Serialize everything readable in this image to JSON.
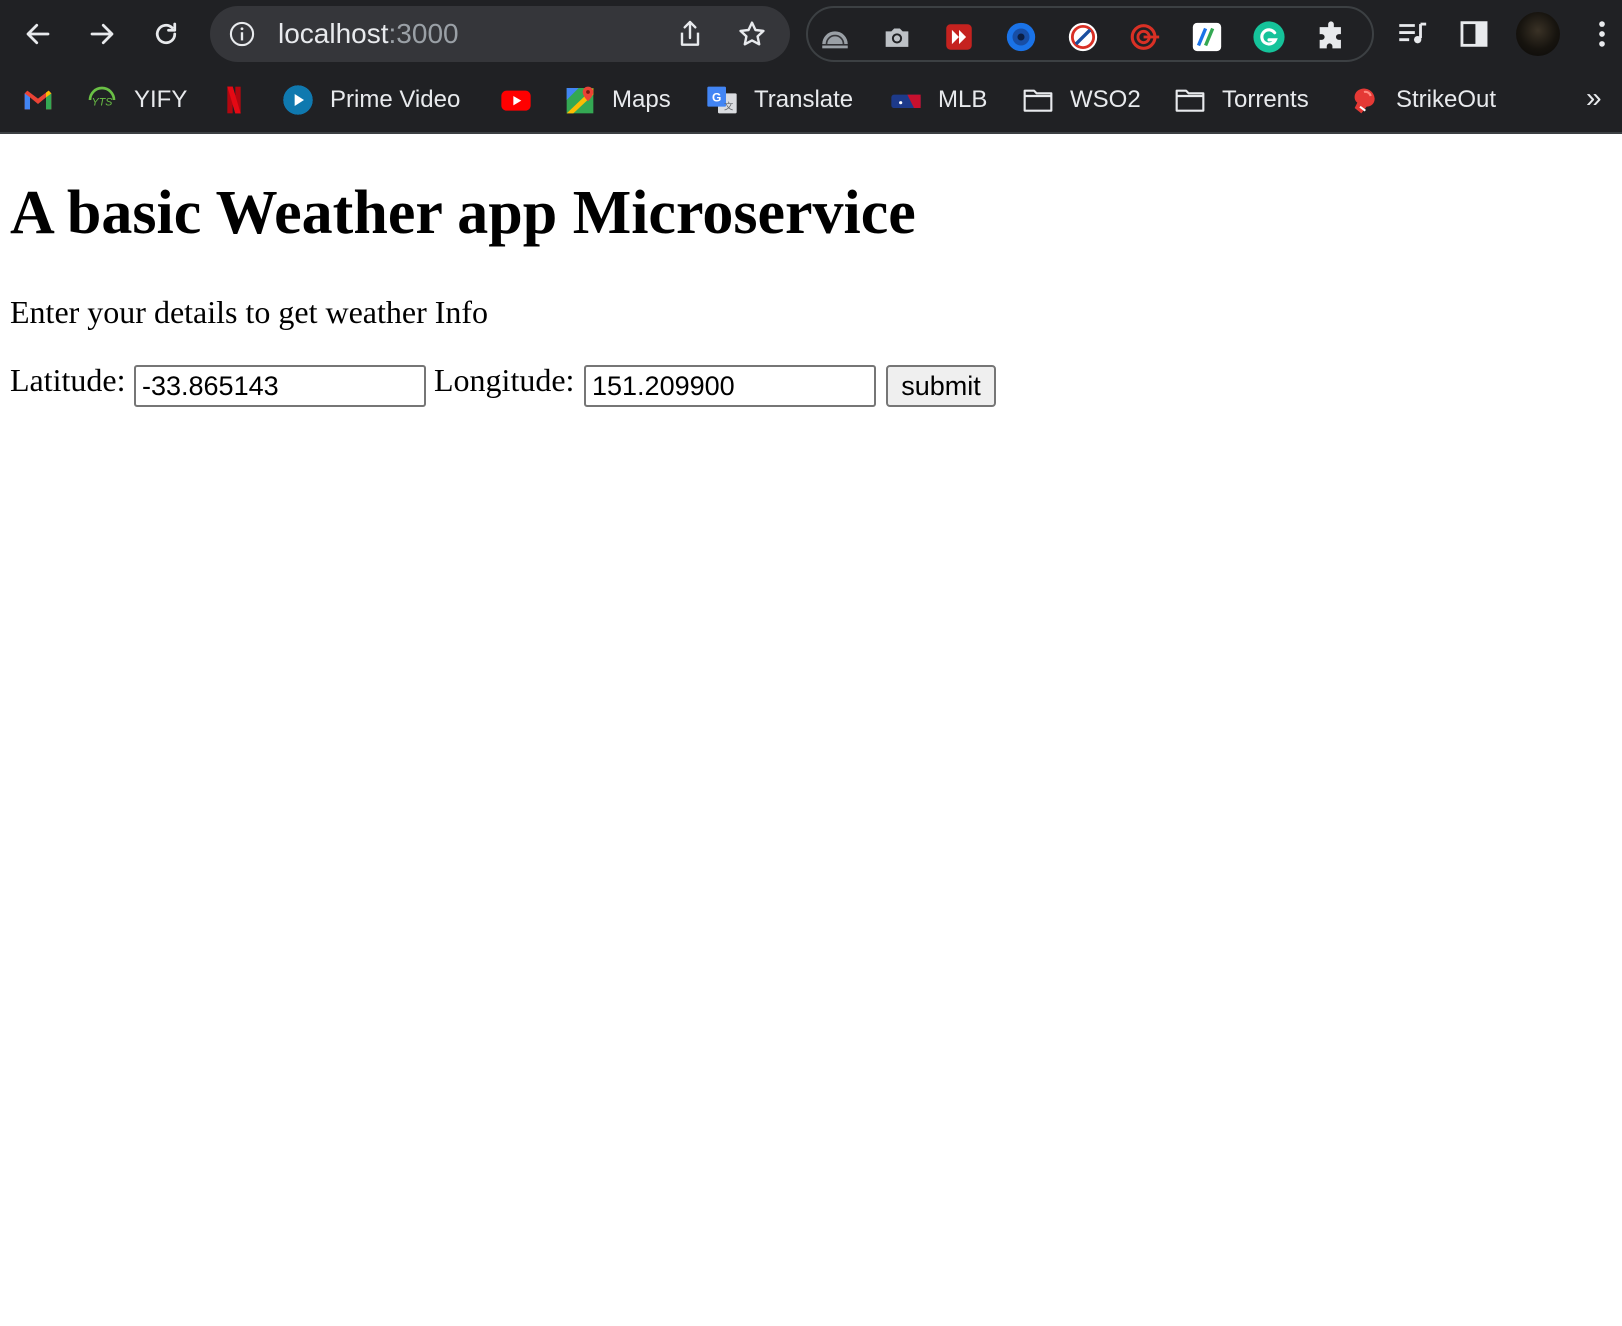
{
  "browser": {
    "address": {
      "host": "localhost",
      "port": ":3000"
    },
    "bookmarks": [
      {
        "label": "",
        "icon": "gmail-icon"
      },
      {
        "label": "YIFY",
        "icon": "yts-icon"
      },
      {
        "label": "",
        "icon": "netflix-icon"
      },
      {
        "label": "Prime Video",
        "icon": "prime-video-icon"
      },
      {
        "label": "",
        "icon": "youtube-icon"
      },
      {
        "label": "Maps",
        "icon": "maps-icon"
      },
      {
        "label": "Translate",
        "icon": "translate-icon"
      },
      {
        "label": "MLB",
        "icon": "mlb-icon"
      },
      {
        "label": "WSO2",
        "icon": "folder-icon"
      },
      {
        "label": "Torrents",
        "icon": "folder-icon"
      },
      {
        "label": "StrikeOut",
        "icon": "boxing-glove-icon"
      }
    ],
    "more_bookmarks": "»"
  },
  "page": {
    "title": "A basic Weather app Microservice",
    "subtitle": "Enter your details to get weather Info",
    "form": {
      "latitude_label": "Latitude:",
      "latitude_value": "-33.865143",
      "longitude_label": "Longitude:",
      "longitude_value": "151.209900",
      "submit_label": "submit"
    }
  }
}
